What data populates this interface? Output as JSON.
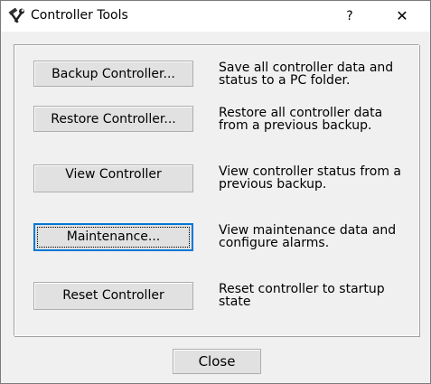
{
  "window": {
    "title": "Controller Tools",
    "help_label": "?",
    "close_glyph": "✕",
    "icon": "tools-icon"
  },
  "actions": [
    {
      "button": "Backup Controller...",
      "desc_line1": "Save all controller data and",
      "desc_line2": "status to a PC folder."
    },
    {
      "button": "Restore Controller...",
      "desc_line1": "Restore all controller data",
      "desc_line2": "from a previous backup."
    },
    {
      "button": "View Controller",
      "desc_line1": "View controller status from a",
      "desc_line2": "previous backup."
    },
    {
      "button": "Maintenance...",
      "desc_line1": "View maintenance data and",
      "desc_line2": "configure alarms."
    },
    {
      "button": "Reset Controller",
      "desc_line1": "Reset controller to startup",
      "desc_line2": "state"
    }
  ],
  "footer": {
    "close_label": "Close"
  },
  "colors": {
    "background": "#f0f0f0",
    "button_face": "#e1e1e1",
    "focus_border": "#0078d7"
  }
}
